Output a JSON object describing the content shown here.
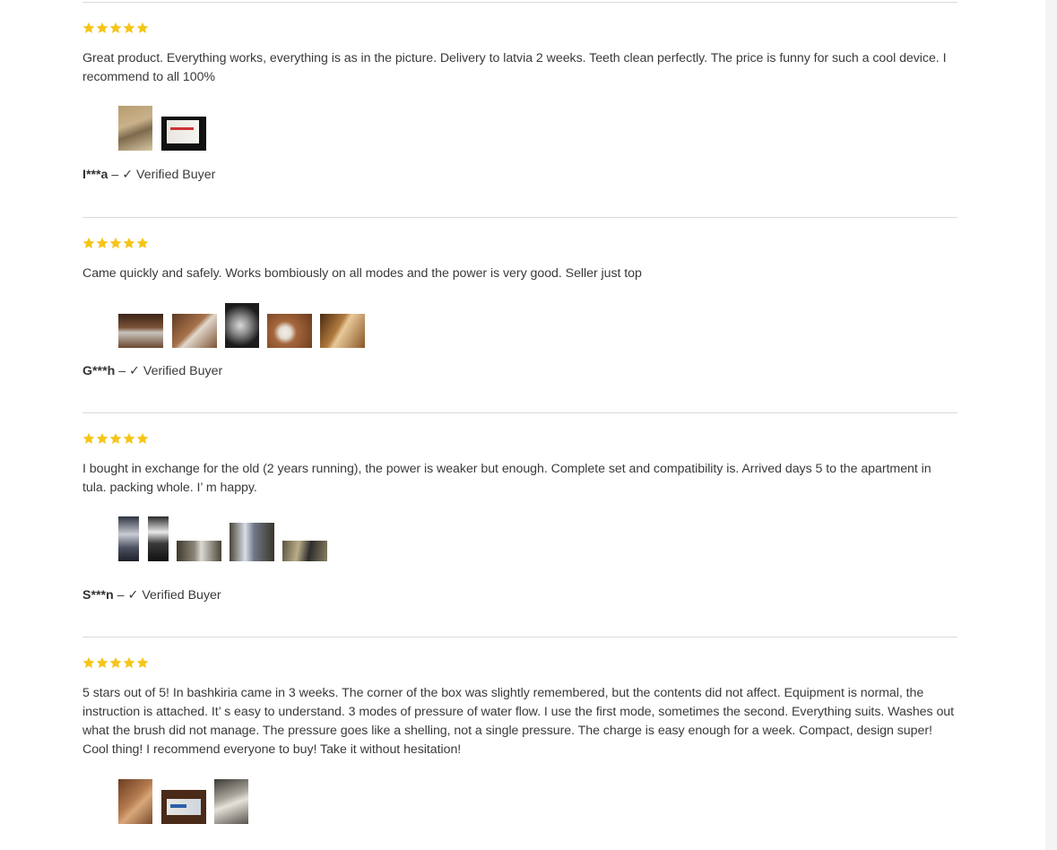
{
  "reviews": [
    {
      "rating": 5,
      "text": "Great product. Everything works, everything is as in the picture. Delivery to latvia 2 weeks. Teeth clean perfectly. The price is funny for such a cool device. I recommend to all 100%",
      "author": "I***a",
      "separator": " – ",
      "check": "✓",
      "verified_label": "Verified Buyer"
    },
    {
      "rating": 5,
      "text": "Came quickly and safely. Works bombiously on all modes and the power is very good. Seller just top",
      "author": "G***h",
      "separator": " – ",
      "check": "✓",
      "verified_label": "Verified Buyer"
    },
    {
      "rating": 5,
      "text": "I bought in exchange for the old (2 years running), the power is weaker but enough. Complete set and compatibility is. Arrived days 5 to the apartment in tula. packing whole. I’ m happy.",
      "author": "S***n",
      "separator": " – ",
      "check": "✓",
      "verified_label": "Verified Buyer"
    },
    {
      "rating": 5,
      "text": "5 stars out of 5! In bashkiria came in 3 weeks. The corner of the box was slightly remembered, but the contents did not affect. Equipment is normal, the instruction is attached. It’ s easy to understand. 3 modes of pressure of water flow. I use the first mode, sometimes the second. Everything suits. Washes out what the brush did not manage. The pressure goes like a shelling, not a single pressure. The charge is easy enough for a week. Compact, design super! Cool thing! I recommend everyone to buy! Take it without hesitation!"
    }
  ],
  "colors": {
    "star": "#f5c518",
    "divider": "#dadada",
    "text": "#3a3a3a"
  },
  "icons": {
    "star": "star-icon",
    "check": "checkmark-icon"
  }
}
